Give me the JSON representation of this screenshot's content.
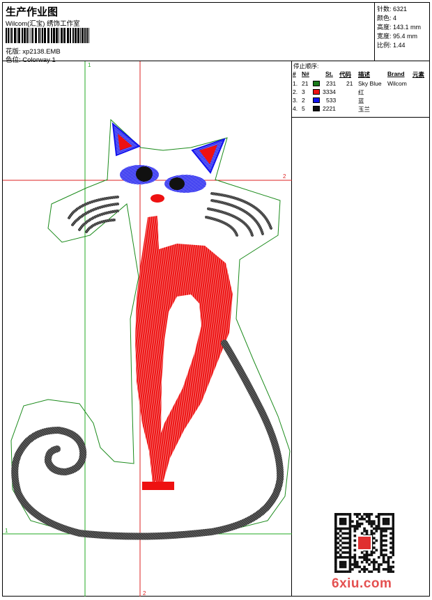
{
  "header": {
    "title": "生产作业图",
    "company": "Wilcom(汇宝) 绣饰工作室",
    "design_label": "花版:",
    "design_name": "xp2138.EMB",
    "colorway_label": "色位:",
    "colorway_name": "Colorway 1"
  },
  "stats": [
    {
      "label": "针数:",
      "value": "6321"
    },
    {
      "label": "颜色:",
      "value": "4"
    },
    {
      "label": "高度:",
      "value": "143.1 mm"
    },
    {
      "label": "宽度:",
      "value": "95.4 mm"
    },
    {
      "label": "比例:",
      "value": "1.44"
    }
  ],
  "stop_sequence": {
    "title": "停止顺序:",
    "columns": [
      "#",
      "N#",
      "St.",
      "代码",
      "描述",
      "Brand",
      "元素"
    ],
    "rows": [
      {
        "no": "1.",
        "needle": "21",
        "color": "#1a7a1a",
        "stitches": "231",
        "code": "21",
        "desc": "Sky Blue",
        "brand": "Wilcom"
      },
      {
        "no": "2.",
        "needle": "3",
        "color": "#ee1111",
        "stitches": "3334",
        "code": "",
        "desc": "红",
        "brand": ""
      },
      {
        "no": "3.",
        "needle": "2",
        "color": "#1111ee",
        "stitches": "533",
        "code": "",
        "desc": "蓝",
        "brand": ""
      },
      {
        "no": "4.",
        "needle": "5",
        "color": "#111111",
        "stitches": "2221",
        "code": "",
        "desc": "玉兰",
        "brand": ""
      }
    ]
  },
  "canvas": {
    "guide_labels": {
      "green_top": "1",
      "green_left": "1",
      "red_right": "2",
      "red_bottom": "2"
    }
  },
  "watermark": "6xiu.com",
  "colors": {
    "guide_green": "#22aa22",
    "guide_red": "#dd2222",
    "thread_red": "#ee1111",
    "thread_blue": "#1111ee",
    "thread_black": "#111111",
    "outline_green": "#1a8a1a"
  }
}
